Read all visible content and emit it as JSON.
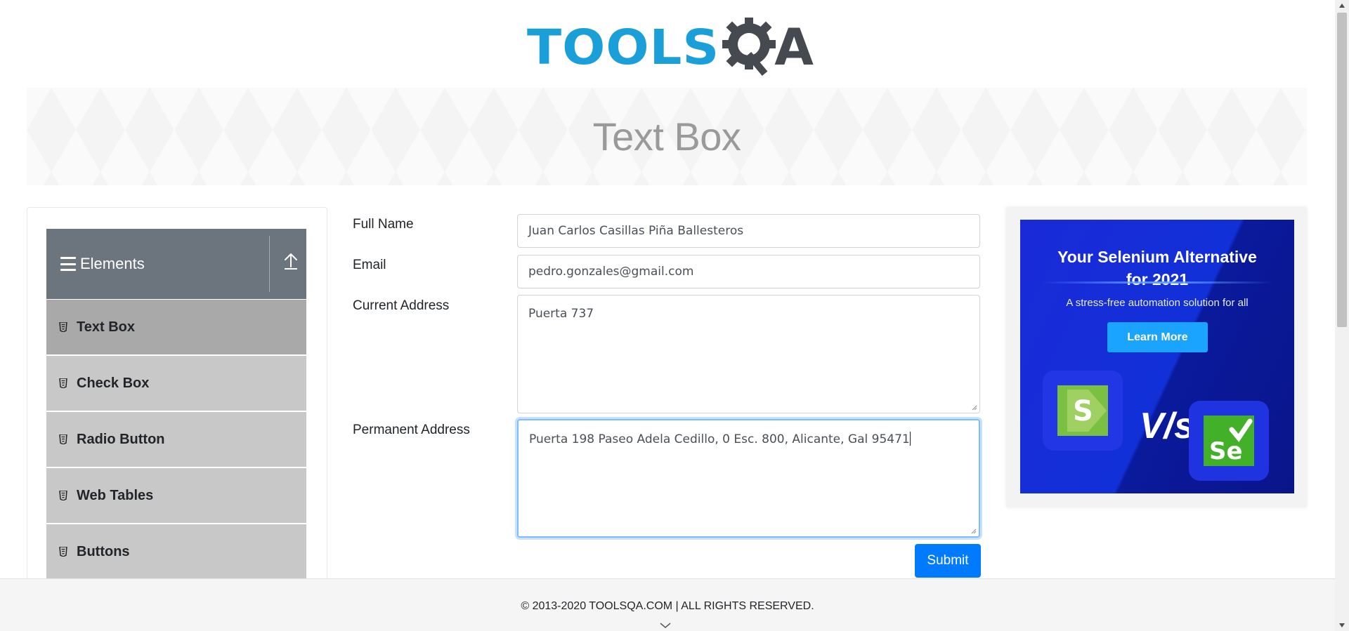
{
  "logo": {
    "text_tools": "TOOLS",
    "text_a": "A"
  },
  "banner": {
    "title": "Text Box"
  },
  "sidebar": {
    "group_title": "Elements",
    "items": [
      {
        "label": "Text Box",
        "active": true
      },
      {
        "label": "Check Box"
      },
      {
        "label": "Radio Button"
      },
      {
        "label": "Web Tables"
      },
      {
        "label": "Buttons"
      }
    ]
  },
  "form": {
    "full_name": {
      "label": "Full Name",
      "value": "Juan Carlos Casillas Piña Ballesteros"
    },
    "email": {
      "label": "Email",
      "value": "pedro.gonzales@gmail.com"
    },
    "current_address": {
      "label": "Current Address",
      "value": "Puerta 737"
    },
    "permanent_address": {
      "label": "Permanent Address",
      "value": "Puerta 198 Paseo Adela Cedillo, 0 Esc. 800, Alicante, Gal 95471"
    },
    "submit_label": "Submit"
  },
  "ad": {
    "title_line1": "Your Selenium Alternative",
    "title_line2": "for 2021",
    "subtitle": "A stress-free automation solution for all",
    "button_label": "Learn More",
    "vs": "V/s",
    "logo_right": "Se"
  },
  "footer": {
    "copyright": "© 2013-2020 TOOLSQA.COM | ALL RIGHTS RESERVED."
  },
  "colors": {
    "logo_blue": "#1a9fd8",
    "sidebar_header": "#6c757d",
    "primary": "#007bff",
    "ad_blue": "#1230d8"
  }
}
